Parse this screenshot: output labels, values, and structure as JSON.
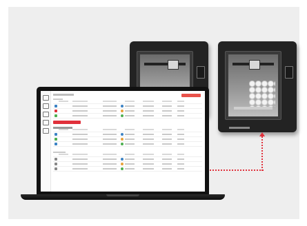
{
  "colors": {
    "accent": "#e0303b",
    "printer_body": "#232323",
    "background": "#eeeeee"
  },
  "app": {
    "sidebar_icons": [
      "home-icon",
      "printer-icon",
      "folder-icon",
      "user-icon",
      "settings-icon"
    ],
    "queue_rows": [
      {
        "status_color": "#3b82c4",
        "dot_color": "#3b82c4"
      },
      {
        "status_color": "#e8a13a",
        "dot_color": "#e0303b"
      },
      {
        "status_color": "#4caf50",
        "dot_color": "#4caf50"
      }
    ],
    "printing_rows": [
      {
        "status_color": "#3b82c4",
        "dot_color": "#3b82c4"
      },
      {
        "status_color": "#e8a13a",
        "dot_color": "#4caf50"
      },
      {
        "status_color": "#4caf50",
        "dot_color": "#3b82c4"
      }
    ],
    "history_rows": [
      {
        "status_color": "#3b82c4",
        "dot_color": "#888888"
      },
      {
        "status_color": "#e8a13a",
        "dot_color": "#888888"
      },
      {
        "status_color": "#4caf50",
        "dot_color": "#888888"
      }
    ]
  }
}
